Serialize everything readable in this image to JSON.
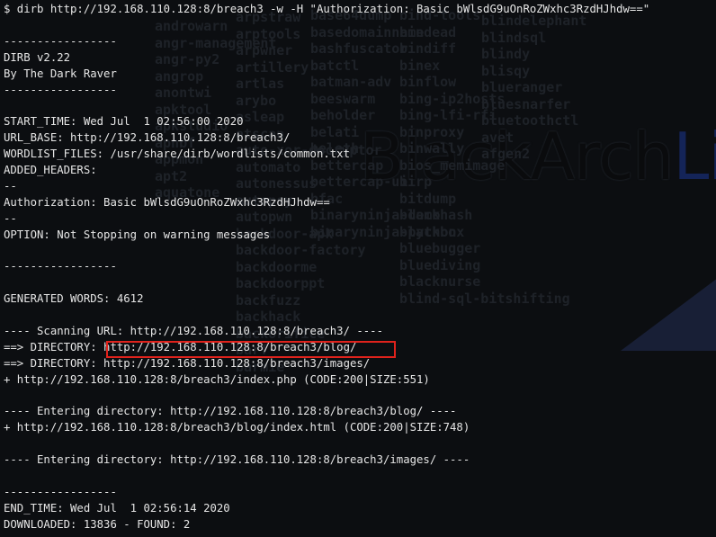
{
  "colors": {
    "background": "#0c0e11",
    "text": "#e6e6e6",
    "highlight_border": "#e0221c",
    "logo_accent": "#142458"
  },
  "wallpaper": {
    "logo_text_black": "BlackArch",
    "logo_text_linux": "Linux",
    "tool_names": [
      "androwarn",
      "angr-management",
      "angr-py2",
      "angrop",
      "anontwi",
      "apktool",
      "apkstudio",
      "apnbf",
      "appmon",
      "apt2",
      "aquatone",
      "arpstraw",
      "arptools",
      "arpwner",
      "artillery",
      "artlas",
      "arybo",
      "asleap",
      "atscan",
      "auto-xor-decryptor",
      "automato",
      "autonessus",
      "autopsy",
      "autopwn",
      "backdoor-apk",
      "backdoor-factory",
      "backdoorme",
      "backdoorppt",
      "backfuzz",
      "backhack",
      "backorifice",
      "barf",
      "barmie",
      "base64dump",
      "basedomainname",
      "bashfuscator",
      "batctl",
      "batman-adv",
      "beeswarm",
      "beholder",
      "belati",
      "beleth",
      "bettercap",
      "bettercap-ui",
      "bfac",
      "binaryninja-demo",
      "binaryninja-python",
      "bind-tools",
      "bindead",
      "bindiff",
      "binex",
      "binflow",
      "bing-ip2hosts",
      "bing-lfi-rfi",
      "binproxy",
      "binwally",
      "bios_memimage",
      "birp",
      "bitdump",
      "blackhash",
      "blackbox",
      "bluebugger",
      "bluediving",
      "blacknurse",
      "blind-sql-bitshifting",
      "blindelephant",
      "blindsql",
      "blindy",
      "blisqy",
      "blueranger",
      "bluesnarfer",
      "bluetoothctl",
      "avet",
      "afgen2"
    ]
  },
  "terminal": {
    "lines": [
      "$ dirb http://192.168.110.128:8/breach3 -w -H \"Authorization: Basic bWlsdG9uOnRoZWxhc3RzdHJhdw==\"",
      "",
      "-----------------",
      "DIRB v2.22",
      "By The Dark Raver",
      "-----------------",
      "",
      "START_TIME: Wed Jul  1 02:56:00 2020",
      "URL_BASE: http://192.168.110.128:8/breach3/",
      "WORDLIST_FILES: /usr/share/dirb/wordlists/common.txt",
      "ADDED_HEADERS:",
      "--",
      "Authorization: Basic bWlsdG9uOnRoZWxhc3RzdHJhdw==",
      "--",
      "OPTION: Not Stopping on warning messages",
      "",
      "-----------------",
      "",
      "GENERATED WORDS: 4612",
      "",
      "---- Scanning URL: http://192.168.110.128:8/breach3/ ----",
      "==> DIRECTORY: http://192.168.110.128:8/breach3/blog/",
      "==> DIRECTORY: http://192.168.110.128:8/breach3/images/",
      "+ http://192.168.110.128:8/breach3/index.php (CODE:200|SIZE:551)",
      "",
      "---- Entering directory: http://192.168.110.128:8/breach3/blog/ ----",
      "+ http://192.168.110.128:8/breach3/blog/index.html (CODE:200|SIZE:748)",
      "",
      "---- Entering directory: http://192.168.110.128:8/breach3/images/ ----",
      "",
      "-----------------",
      "END_TIME: Wed Jul  1 02:56:14 2020",
      "DOWNLOADED: 13836 - FOUND: 2"
    ]
  }
}
